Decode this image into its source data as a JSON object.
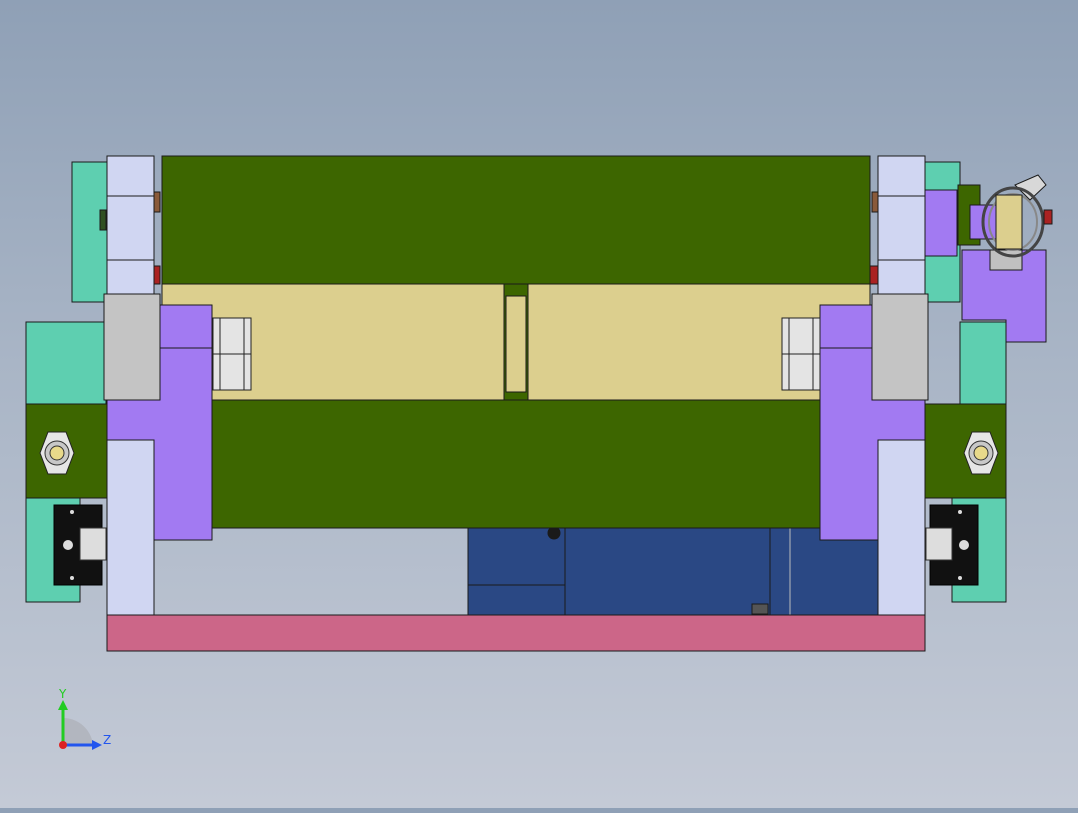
{
  "viewport": {
    "background_top": "#8fa0b6",
    "background_bottom": "#c4cad6"
  },
  "colors": {
    "green_roller": "#3d6600",
    "cream_shaft": "#dccf8e",
    "lilac_block": "#d0d6f2",
    "purple_bracket": "#a27af2",
    "teal_frame": "#5ecfb0",
    "pink_base": "#cc6688",
    "navy_motor": "#2a4884",
    "grey_spacer": "#c4c4c4",
    "outline": "#1a1a1a"
  },
  "triad": {
    "y_label": "Y",
    "z_label": "Z",
    "y_color": "#22cc22",
    "z_color": "#2255ee",
    "x_color": "#dd2222"
  }
}
